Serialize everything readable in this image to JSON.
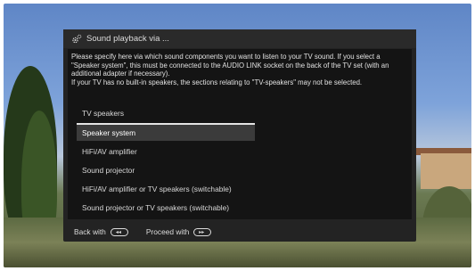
{
  "dialog": {
    "title": "Sound playback via ...",
    "description_lines": [
      "Please specify here via which sound components you want to listen to your TV sound. If you select a \"Speaker system\", this must be connected to the AUDIO LINK socket on the back of the TV set (with an additional adapter if necessary).",
      "If your TV has no built-in speakers, the sections relating to \"TV-speakers\" may not be selected."
    ],
    "options": [
      {
        "label": "TV speakers",
        "selected": false
      },
      {
        "label": "Speaker system",
        "selected": true
      },
      {
        "label": "HiFi/AV amplifier",
        "selected": false
      },
      {
        "label": "Sound projector",
        "selected": false
      },
      {
        "label": "HiFi/AV amplifier or TV speakers (switchable)",
        "selected": false
      },
      {
        "label": "Sound projector or TV speakers (switchable)",
        "selected": false
      }
    ]
  },
  "footer": {
    "back_label": "Back with",
    "back_icon": "rewind-key-icon",
    "proceed_label": "Proceed with",
    "proceed_icon": "fast-forward-key-icon"
  },
  "colors": {
    "dialog_bg": "#232323",
    "content_bg": "#141414",
    "selected_bg": "#3b3b3b",
    "text": "#e0e0e0"
  }
}
